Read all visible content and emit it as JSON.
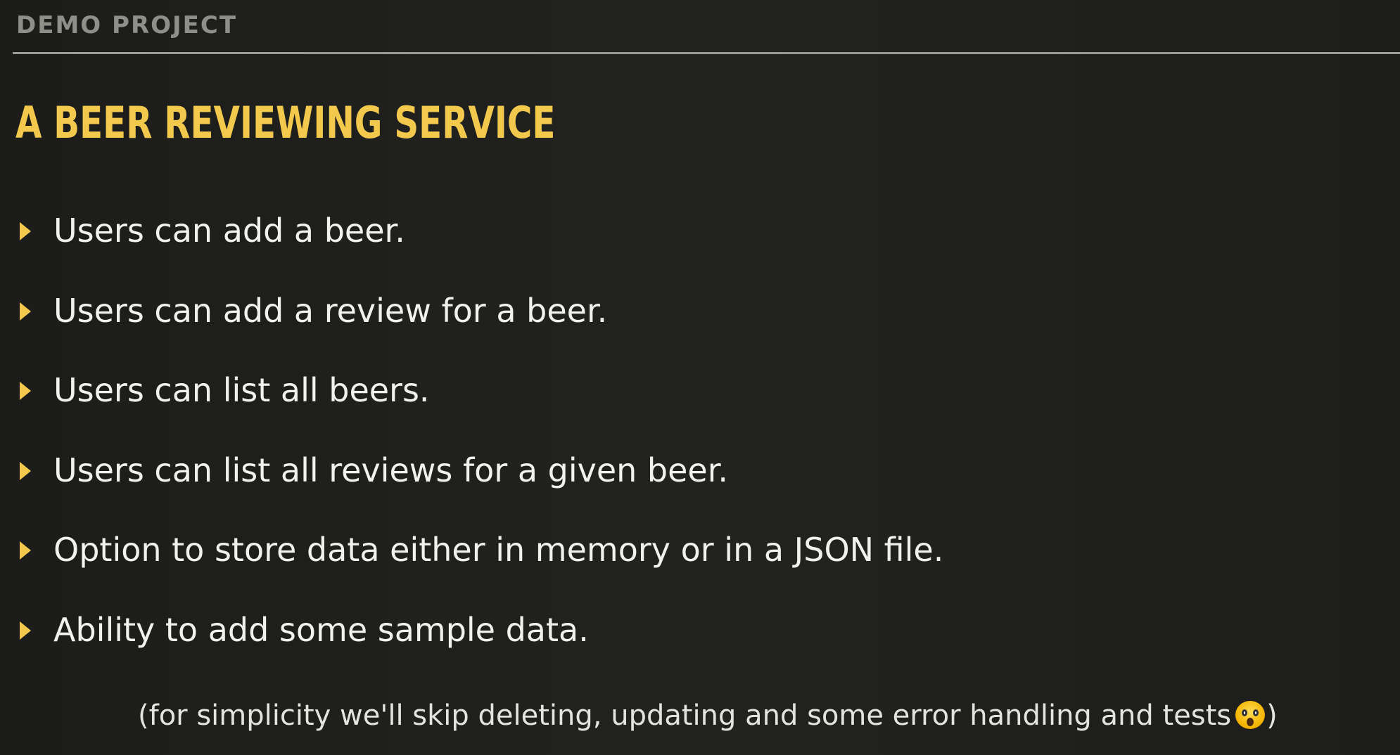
{
  "header": {
    "section_label": "DEMO PROJECT"
  },
  "slide": {
    "title": "A BEER REVIEWING SERVICE",
    "bullets": [
      {
        "text": "Users can add a beer."
      },
      {
        "text": "Users can add a review for a beer."
      },
      {
        "text": "Users can list all beers."
      },
      {
        "text": "Users can list all reviews for a given beer."
      },
      {
        "text": "Option to store data either in memory or in a JSON file."
      },
      {
        "text": "Ability to add some sample data."
      }
    ],
    "footnote": {
      "open_paren": "(",
      "text": "for simplicity we'll skip deleting, updating and some error handling and tests",
      "emoji": "scream-emoji",
      "close_paren": ")"
    }
  },
  "colors": {
    "background": "#1f1f1c",
    "accent": "#f2c94c",
    "text": "#f1f1ee",
    "muted": "#8f8f8a"
  }
}
